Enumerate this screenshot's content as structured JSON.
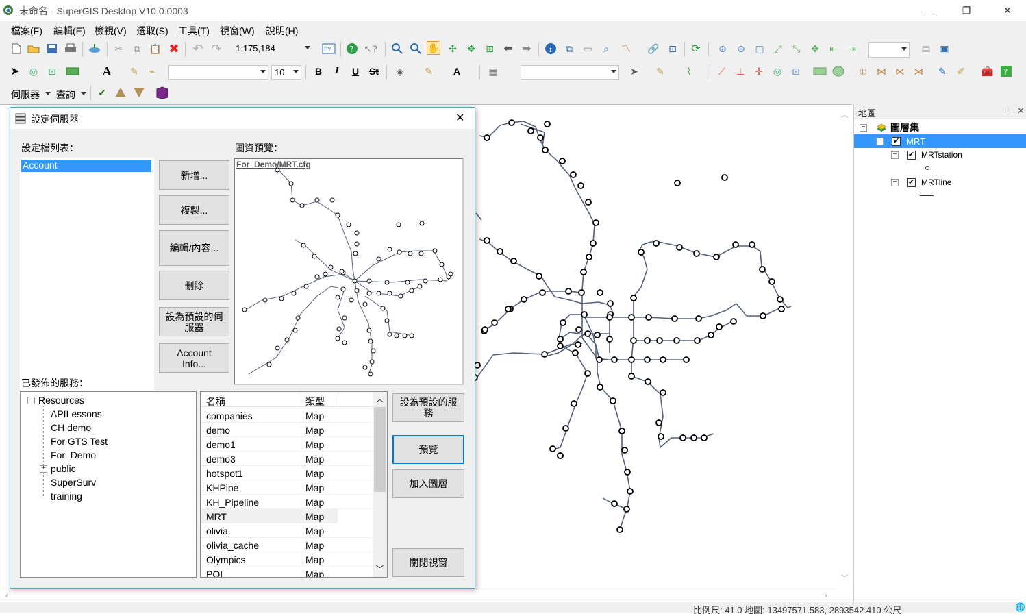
{
  "window": {
    "title": "未命名 - SuperGIS Desktop V10.0.0003",
    "minimize": "—",
    "restore": "❐",
    "close": "✕"
  },
  "menu": [
    "檔案(F)",
    "編輯(E)",
    "檢視(V)",
    "選取(S)",
    "工具(T)",
    "視窗(W)",
    "說明(H)"
  ],
  "toolbar": {
    "scale": "1:175,184",
    "font_size": "10",
    "server_label": "伺服器",
    "query_label": "查詢"
  },
  "toc": {
    "header": "地圖",
    "pin": "📌",
    "close": "✕",
    "root": "圖層集",
    "layer_group": "MRT",
    "layers": [
      "MRTstation",
      "MRTline"
    ]
  },
  "status": {
    "text": "比例尺: 41.0  地圖: 13497571.583, 2893542.410 公尺"
  },
  "dialog": {
    "title": "設定伺服器",
    "close": "✕",
    "config_list_label": "設定檔列表：",
    "config_items": [
      "Account"
    ],
    "preview_label": "圖資預覽：",
    "preview_caption": "For_Demo/MRT.cfg",
    "buttons": {
      "add": "新增...",
      "copy": "複製...",
      "edit": "編輯/內容...",
      "delete": "刪除",
      "set_default_server": "設為預設的伺服器",
      "account_info": "Account Info...",
      "set_default_service": "設為預設的服務",
      "preview": "預覽",
      "add_layer": "加入圖層",
      "close_window": "關閉視窗"
    },
    "published_label": "已發佈的服務：",
    "tree": {
      "root": "Resources",
      "children": [
        "APILessons",
        "CH demo",
        "For GTS Test",
        "For_Demo",
        "public",
        "SuperSurv",
        "training"
      ]
    },
    "table": {
      "headers": [
        "名稱",
        "類型"
      ],
      "rows": [
        [
          "companies",
          "Map"
        ],
        [
          "demo",
          "Map"
        ],
        [
          "demo1",
          "Map"
        ],
        [
          "demo3",
          "Map"
        ],
        [
          "hotspot1",
          "Map"
        ],
        [
          "KHPipe",
          "Map"
        ],
        [
          "KH_Pipeline",
          "Map"
        ],
        [
          "MRT",
          "Map"
        ],
        [
          "olivia",
          "Map"
        ],
        [
          "olivia_cache",
          "Map"
        ],
        [
          "Olympics",
          "Map"
        ],
        [
          "POI",
          "Map"
        ]
      ]
    }
  }
}
